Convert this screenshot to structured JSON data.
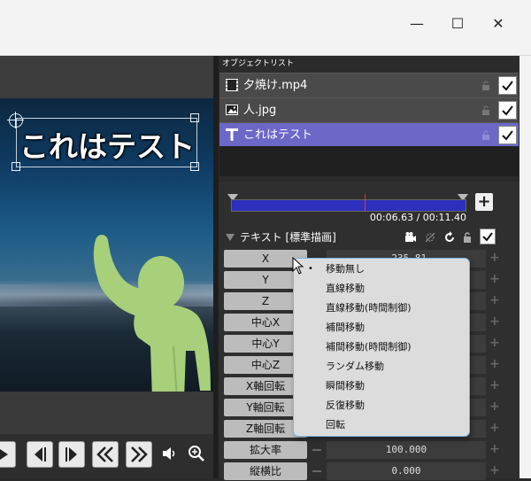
{
  "window": {
    "minimize_label": "—",
    "maximize_label": "☐",
    "close_label": "✕"
  },
  "preview": {
    "text_object": "これはテスト"
  },
  "object_list": {
    "header": "オブジェクトリスト",
    "items": [
      {
        "label": "夕焼け.mp4",
        "icon": "film-icon",
        "checked": true,
        "selected": false
      },
      {
        "label": "人.jpg",
        "icon": "image-icon",
        "checked": true,
        "selected": false
      },
      {
        "label": "これはテスト",
        "icon": "text-icon",
        "checked": true,
        "selected": true
      }
    ]
  },
  "timeline": {
    "time": "00:06.63 / 00:11.40",
    "add_label": "+"
  },
  "properties": {
    "section_label": "テキスト [標準描画]",
    "rows": [
      {
        "name": "X",
        "value": "-235.81"
      },
      {
        "name": "Y",
        "value": ""
      },
      {
        "name": "Z",
        "value": ""
      },
      {
        "name": "中心X",
        "value": ""
      },
      {
        "name": "中心Y",
        "value": ""
      },
      {
        "name": "中心Z",
        "value": ""
      },
      {
        "name": "X軸回転",
        "value": ""
      },
      {
        "name": "Y軸回転",
        "value": ""
      },
      {
        "name": "Z軸回転",
        "value": ""
      },
      {
        "name": "拡大率",
        "value": "100.000"
      },
      {
        "name": "縦横比",
        "value": "0.000"
      }
    ]
  },
  "context_menu": {
    "items": [
      {
        "label": "移動無し",
        "checked": true
      },
      {
        "label": "直線移動",
        "checked": false
      },
      {
        "label": "直線移動(時間制御)",
        "checked": false
      },
      {
        "label": "補間移動",
        "checked": false
      },
      {
        "label": "補間移動(時間制御)",
        "checked": false
      },
      {
        "label": "ランダム移動",
        "checked": false
      },
      {
        "label": "瞬間移動",
        "checked": false
      },
      {
        "label": "反復移動",
        "checked": false
      },
      {
        "label": "回転",
        "checked": false
      }
    ],
    "bullet": "•"
  },
  "colors": {
    "selected_row": "#6b68c8",
    "timeline_bar": "#2d2fbd",
    "menu_border": "#7fb3e0"
  }
}
